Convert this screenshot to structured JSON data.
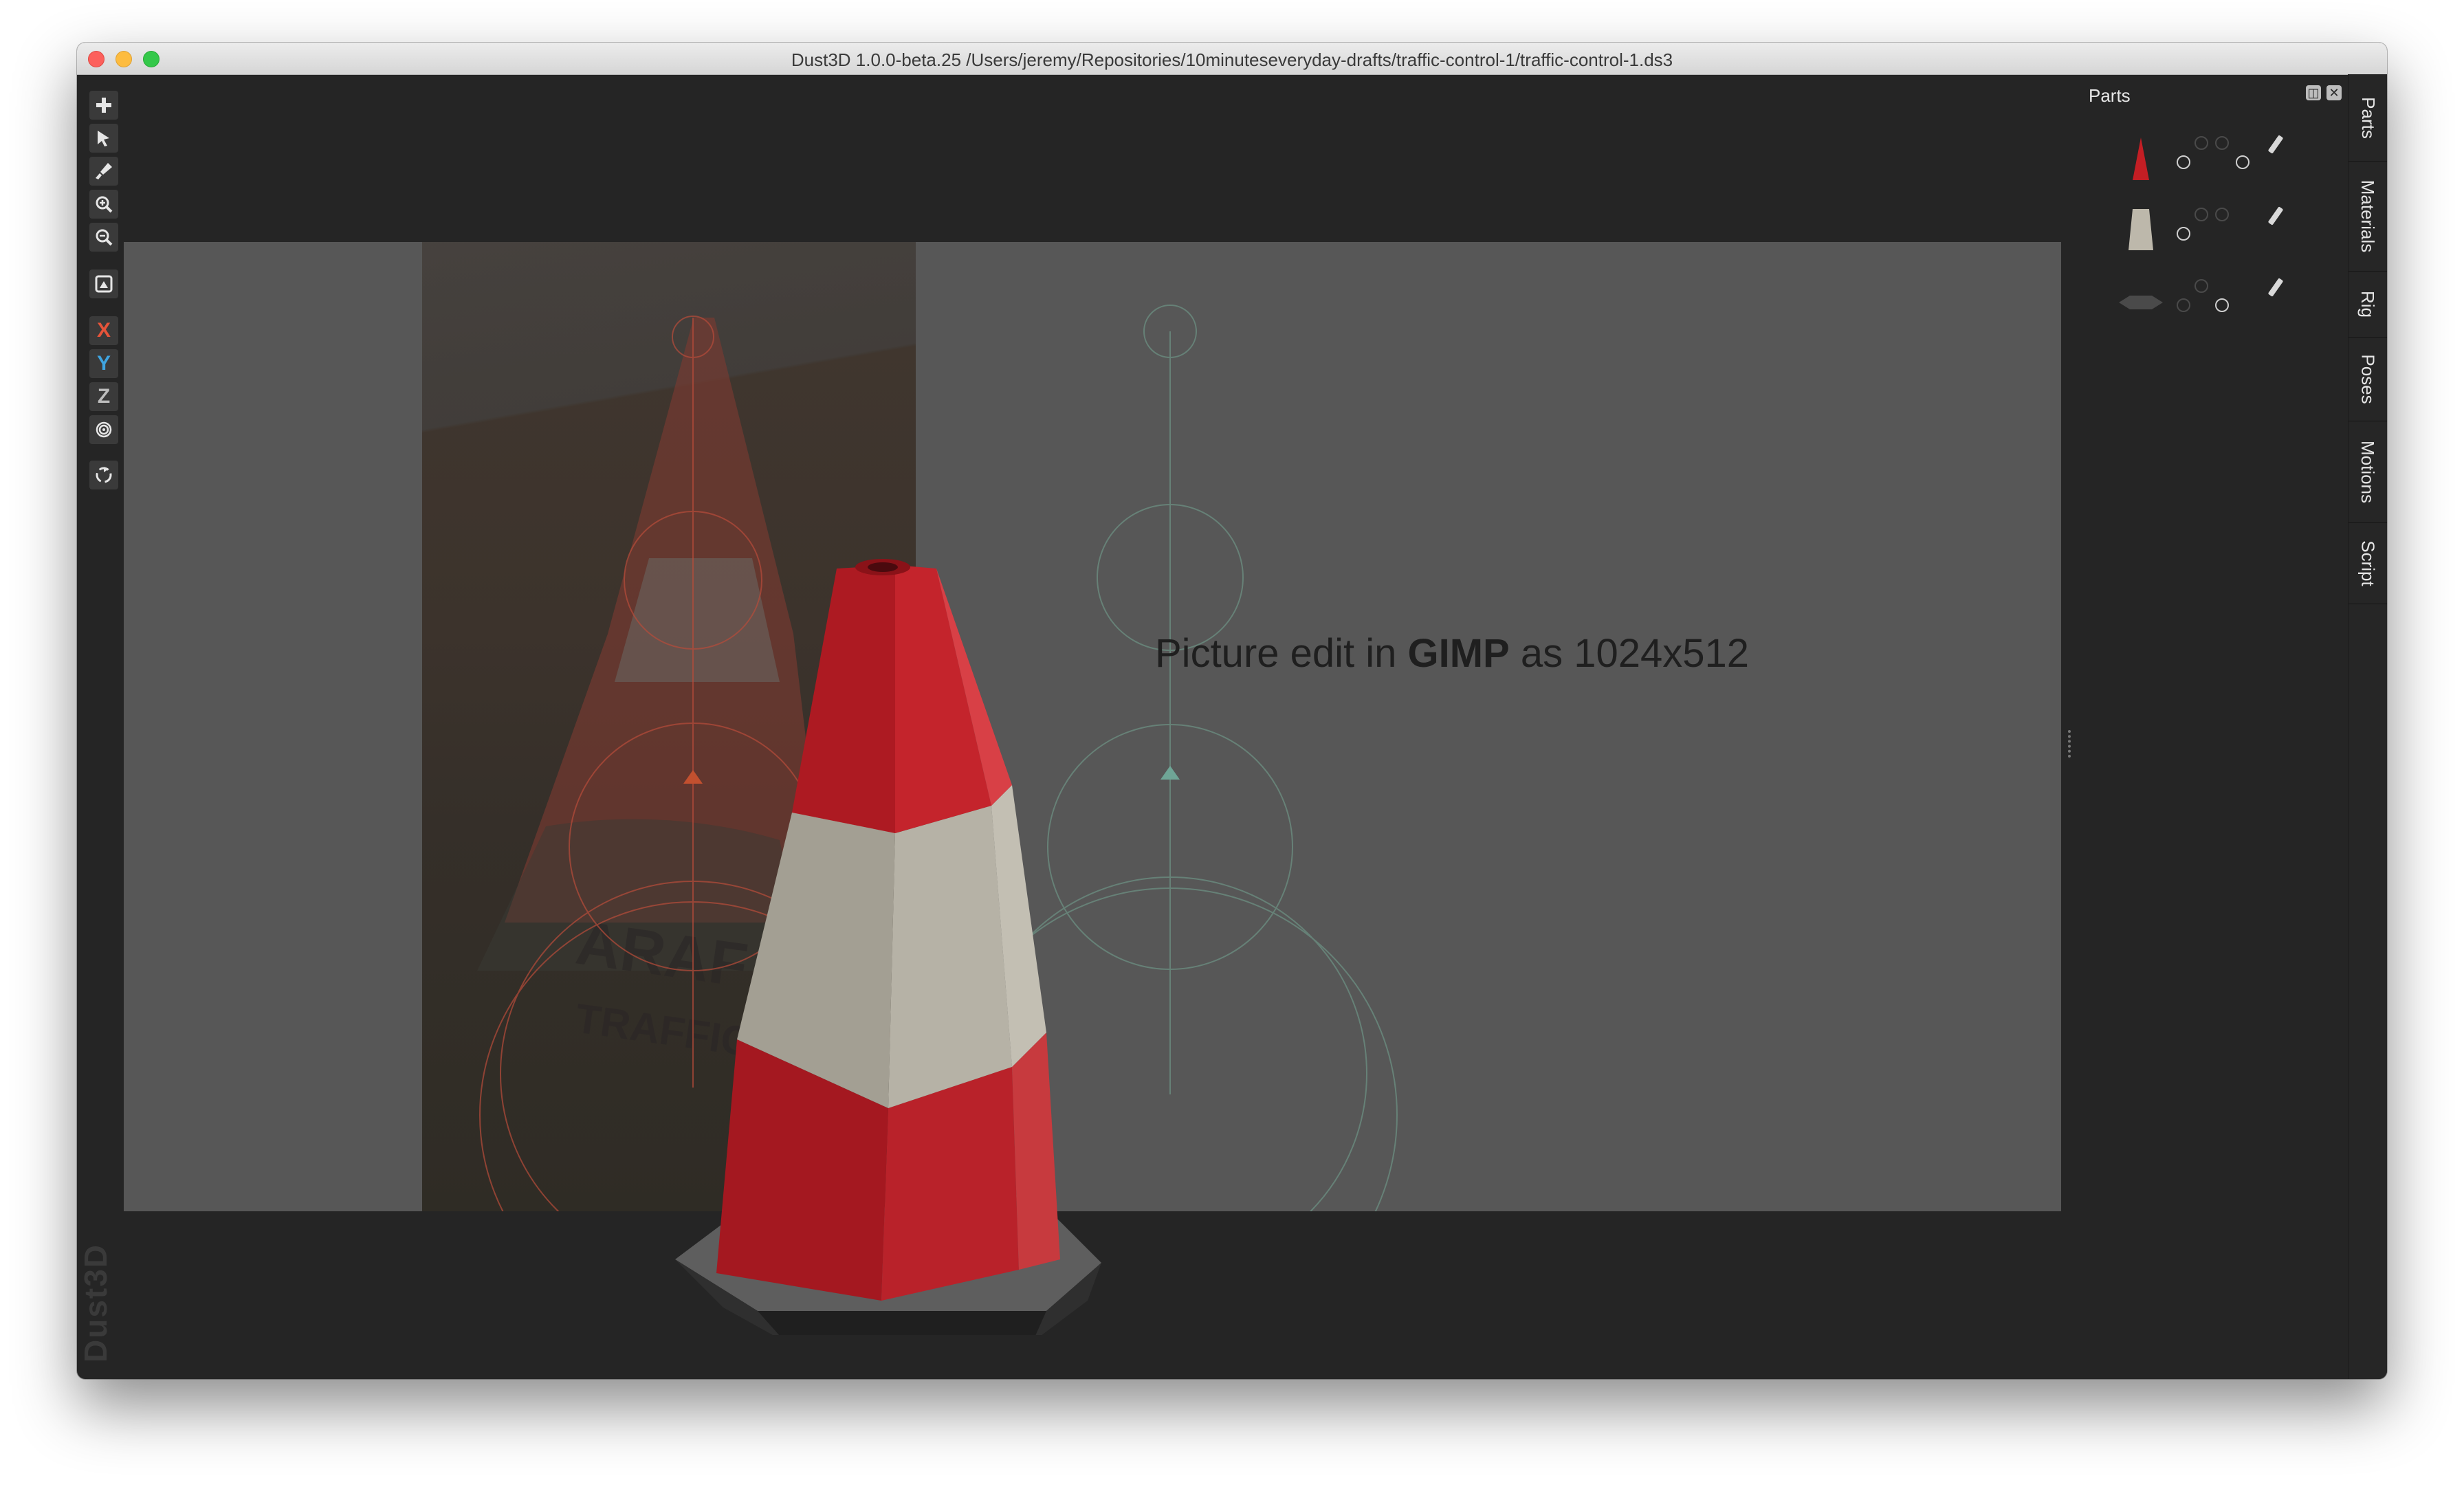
{
  "window": {
    "title": "Dust3D 1.0.0-beta.25 /Users/jeremy/Repositories/10minuteseveryday-drafts/traffic-control-1/traffic-control-1.ds3"
  },
  "toolbar": {
    "tools": [
      {
        "name": "add-tool-icon",
        "label": "+"
      },
      {
        "name": "select-tool-icon",
        "label": ""
      },
      {
        "name": "paint-tool-icon",
        "label": ""
      },
      {
        "name": "zoom-in-icon",
        "label": ""
      },
      {
        "name": "zoom-out-icon",
        "label": ""
      },
      {
        "name": "image-icon",
        "label": ""
      },
      {
        "name": "axis-x",
        "label": "X"
      },
      {
        "name": "axis-y",
        "label": "Y"
      },
      {
        "name": "axis-z",
        "label": "Z"
      },
      {
        "name": "radial-icon",
        "label": ""
      },
      {
        "name": "recycle-icon",
        "label": ""
      }
    ],
    "watermark": "Dust3D"
  },
  "canvas": {
    "text_prefix": "Picture edit in ",
    "text_bold": "GIMP",
    "text_suffix": " as 1024x512"
  },
  "parts_panel": {
    "title": "Parts",
    "parts": [
      {
        "name": "part-red-cone",
        "color": "#c31e24"
      },
      {
        "name": "part-white-band",
        "color": "#c8c4b8"
      },
      {
        "name": "part-base",
        "color": "#3d3d3d"
      }
    ]
  },
  "side_tabs": [
    "Parts",
    "Materials",
    "Rig",
    "Poses",
    "Motions",
    "Script"
  ],
  "colors": {
    "accent_red": "#c31e24",
    "band_white": "#bdb8ab",
    "panel_bg": "#252525",
    "canvas_bg": "#575757"
  }
}
